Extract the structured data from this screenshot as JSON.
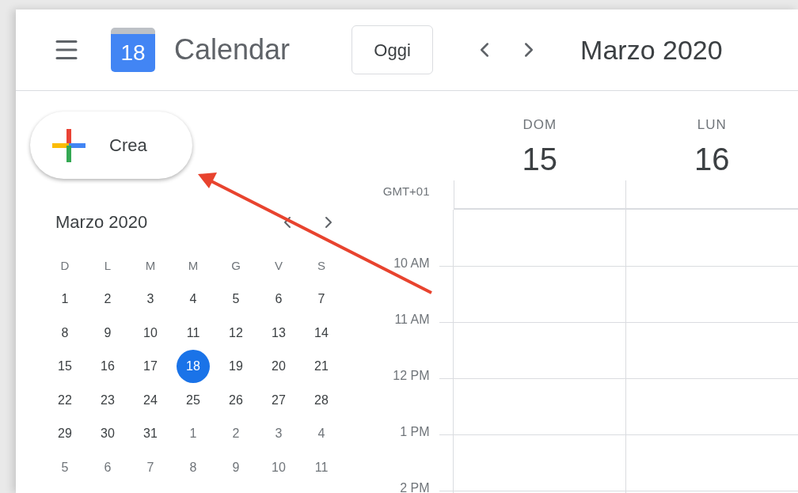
{
  "header": {
    "app_name": "Calendar",
    "logo_day": "18",
    "today_button": "Oggi",
    "period": "Marzo 2020"
  },
  "create_button": "Crea",
  "mini_calendar": {
    "title": "Marzo 2020",
    "weekdays": [
      "D",
      "L",
      "M",
      "M",
      "G",
      "V",
      "S"
    ],
    "weeks": [
      [
        {
          "label": "1",
          "in_month": true,
          "selected": false
        },
        {
          "label": "2",
          "in_month": true,
          "selected": false
        },
        {
          "label": "3",
          "in_month": true,
          "selected": false
        },
        {
          "label": "4",
          "in_month": true,
          "selected": false
        },
        {
          "label": "5",
          "in_month": true,
          "selected": false
        },
        {
          "label": "6",
          "in_month": true,
          "selected": false
        },
        {
          "label": "7",
          "in_month": true,
          "selected": false
        }
      ],
      [
        {
          "label": "8",
          "in_month": true,
          "selected": false
        },
        {
          "label": "9",
          "in_month": true,
          "selected": false
        },
        {
          "label": "10",
          "in_month": true,
          "selected": false
        },
        {
          "label": "11",
          "in_month": true,
          "selected": false
        },
        {
          "label": "12",
          "in_month": true,
          "selected": false
        },
        {
          "label": "13",
          "in_month": true,
          "selected": false
        },
        {
          "label": "14",
          "in_month": true,
          "selected": false
        }
      ],
      [
        {
          "label": "15",
          "in_month": true,
          "selected": false
        },
        {
          "label": "16",
          "in_month": true,
          "selected": false
        },
        {
          "label": "17",
          "in_month": true,
          "selected": false
        },
        {
          "label": "18",
          "in_month": true,
          "selected": true
        },
        {
          "label": "19",
          "in_month": true,
          "selected": false
        },
        {
          "label": "20",
          "in_month": true,
          "selected": false
        },
        {
          "label": "21",
          "in_month": true,
          "selected": false
        }
      ],
      [
        {
          "label": "22",
          "in_month": true,
          "selected": false
        },
        {
          "label": "23",
          "in_month": true,
          "selected": false
        },
        {
          "label": "24",
          "in_month": true,
          "selected": false
        },
        {
          "label": "25",
          "in_month": true,
          "selected": false
        },
        {
          "label": "26",
          "in_month": true,
          "selected": false
        },
        {
          "label": "27",
          "in_month": true,
          "selected": false
        },
        {
          "label": "28",
          "in_month": true,
          "selected": false
        }
      ],
      [
        {
          "label": "29",
          "in_month": true,
          "selected": false
        },
        {
          "label": "30",
          "in_month": true,
          "selected": false
        },
        {
          "label": "31",
          "in_month": true,
          "selected": false
        },
        {
          "label": "1",
          "in_month": false,
          "selected": false
        },
        {
          "label": "2",
          "in_month": false,
          "selected": false
        },
        {
          "label": "3",
          "in_month": false,
          "selected": false
        },
        {
          "label": "4",
          "in_month": false,
          "selected": false
        }
      ],
      [
        {
          "label": "5",
          "in_month": false,
          "selected": false
        },
        {
          "label": "6",
          "in_month": false,
          "selected": false
        },
        {
          "label": "7",
          "in_month": false,
          "selected": false
        },
        {
          "label": "8",
          "in_month": false,
          "selected": false
        },
        {
          "label": "9",
          "in_month": false,
          "selected": false
        },
        {
          "label": "10",
          "in_month": false,
          "selected": false
        },
        {
          "label": "11",
          "in_month": false,
          "selected": false
        }
      ]
    ]
  },
  "days": [
    {
      "weekday": "DOM",
      "date": "15"
    },
    {
      "weekday": "LUN",
      "date": "16"
    }
  ],
  "timezone": "GMT+01",
  "hours": [
    "10 AM",
    "11 AM",
    "12 PM",
    "1 PM",
    "2 PM"
  ]
}
